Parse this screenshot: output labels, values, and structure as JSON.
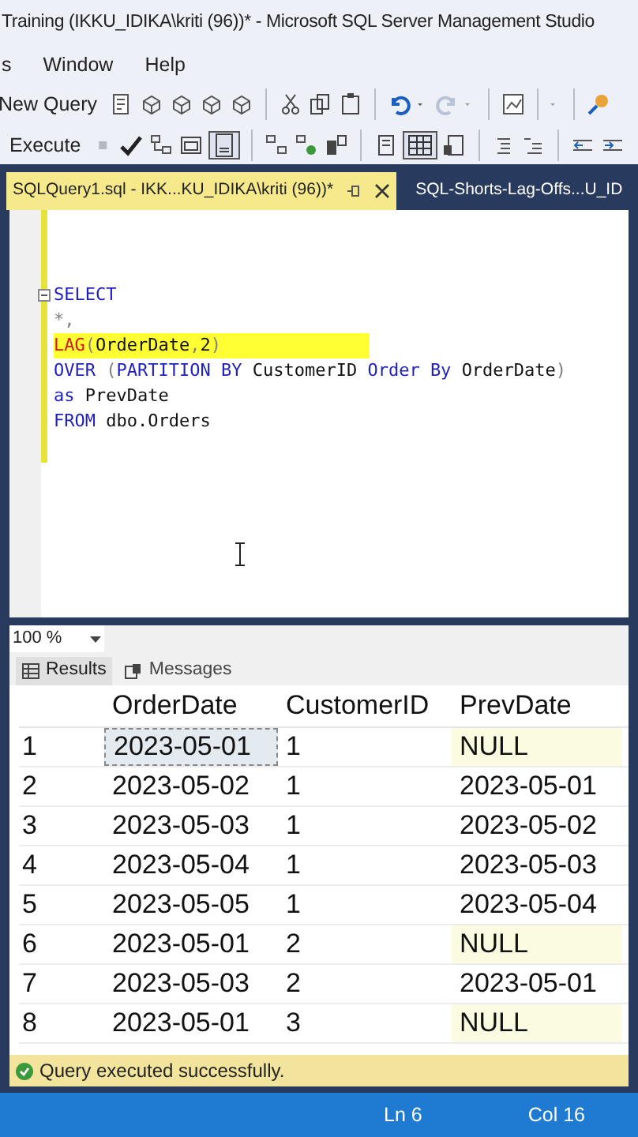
{
  "window": {
    "title": "Training (IKKU_IDIKA\\kriti (96))* - Microsoft SQL Server Management Studio"
  },
  "menu": [
    "s",
    "Window",
    "Help"
  ],
  "toolbar": {
    "new_query": "New Query",
    "execute": "Execute"
  },
  "tabs": [
    {
      "label": "SQLQuery1.sql - IKK...KU_IDIKA\\kriti (96))*",
      "selected": true
    },
    {
      "label": "SQL-Shorts-Lag-Offs...U_ID",
      "selected": false
    }
  ],
  "editor": {
    "lines": [
      {
        "highlighted": false,
        "fold": true,
        "tokens": [
          {
            "kind": "keyword",
            "text": "SELECT"
          }
        ]
      },
      {
        "highlighted": false,
        "fold": false,
        "tokens": [
          {
            "kind": "operator",
            "text": "*,"
          }
        ]
      },
      {
        "highlighted": true,
        "fold": false,
        "tokens": [
          {
            "kind": "function",
            "text": "LAG"
          },
          {
            "kind": "operator",
            "text": "("
          },
          {
            "kind": "plain",
            "text": "OrderDate"
          },
          {
            "kind": "operator",
            "text": ","
          },
          {
            "kind": "plain",
            "text": "2"
          },
          {
            "kind": "operator",
            "text": ")"
          }
        ]
      },
      {
        "highlighted": false,
        "fold": false,
        "tokens": [
          {
            "kind": "keyword",
            "text": "OVER "
          },
          {
            "kind": "operator",
            "text": "("
          },
          {
            "kind": "keyword",
            "text": "PARTITION BY "
          },
          {
            "kind": "plain",
            "text": "CustomerID "
          },
          {
            "kind": "keyword",
            "text": "Order By "
          },
          {
            "kind": "plain",
            "text": "OrderDate"
          },
          {
            "kind": "operator",
            "text": ")"
          }
        ]
      },
      {
        "highlighted": false,
        "fold": false,
        "tokens": [
          {
            "kind": "keyword",
            "text": "as "
          },
          {
            "kind": "plain",
            "text": "PrevDate"
          }
        ]
      },
      {
        "highlighted": false,
        "fold": false,
        "tokens": [
          {
            "kind": "keyword",
            "text": "FROM "
          },
          {
            "kind": "plain",
            "text": "dbo.Orders"
          }
        ]
      }
    ]
  },
  "zoom": "100 %",
  "result_tabs": [
    {
      "label": "Results",
      "selected": true
    },
    {
      "label": "Messages",
      "selected": false
    }
  ],
  "grid": {
    "columns": [
      "OrderDate",
      "CustomerID",
      "PrevDate"
    ],
    "rows": [
      {
        "number": "1",
        "cells": [
          {
            "text": "2023-05-01",
            "selected": true,
            "is_null": false
          },
          {
            "text": "1",
            "selected": false,
            "is_null": false
          },
          {
            "text": "NULL",
            "selected": false,
            "is_null": true
          }
        ]
      },
      {
        "number": "2",
        "cells": [
          {
            "text": "2023-05-02",
            "selected": false,
            "is_null": false
          },
          {
            "text": "1",
            "selected": false,
            "is_null": false
          },
          {
            "text": "2023-05-01",
            "selected": false,
            "is_null": false
          }
        ]
      },
      {
        "number": "3",
        "cells": [
          {
            "text": "2023-05-03",
            "selected": false,
            "is_null": false
          },
          {
            "text": "1",
            "selected": false,
            "is_null": false
          },
          {
            "text": "2023-05-02",
            "selected": false,
            "is_null": false
          }
        ]
      },
      {
        "number": "4",
        "cells": [
          {
            "text": "2023-05-04",
            "selected": false,
            "is_null": false
          },
          {
            "text": "1",
            "selected": false,
            "is_null": false
          },
          {
            "text": "2023-05-03",
            "selected": false,
            "is_null": false
          }
        ]
      },
      {
        "number": "5",
        "cells": [
          {
            "text": "2023-05-05",
            "selected": false,
            "is_null": false
          },
          {
            "text": "1",
            "selected": false,
            "is_null": false
          },
          {
            "text": "2023-05-04",
            "selected": false,
            "is_null": false
          }
        ]
      },
      {
        "number": "6",
        "cells": [
          {
            "text": "2023-05-01",
            "selected": false,
            "is_null": false
          },
          {
            "text": "2",
            "selected": false,
            "is_null": false
          },
          {
            "text": "NULL",
            "selected": false,
            "is_null": true
          }
        ]
      },
      {
        "number": "7",
        "cells": [
          {
            "text": "2023-05-03",
            "selected": false,
            "is_null": false
          },
          {
            "text": "2",
            "selected": false,
            "is_null": false
          },
          {
            "text": "2023-05-01",
            "selected": false,
            "is_null": false
          }
        ]
      },
      {
        "number": "8",
        "cells": [
          {
            "text": "2023-05-01",
            "selected": false,
            "is_null": false
          },
          {
            "text": "3",
            "selected": false,
            "is_null": false
          },
          {
            "text": "NULL",
            "selected": false,
            "is_null": true
          }
        ]
      }
    ]
  },
  "query_status": "Query executed successfully.",
  "status_bar": {
    "line": "Ln 6",
    "column": "Col 16"
  }
}
